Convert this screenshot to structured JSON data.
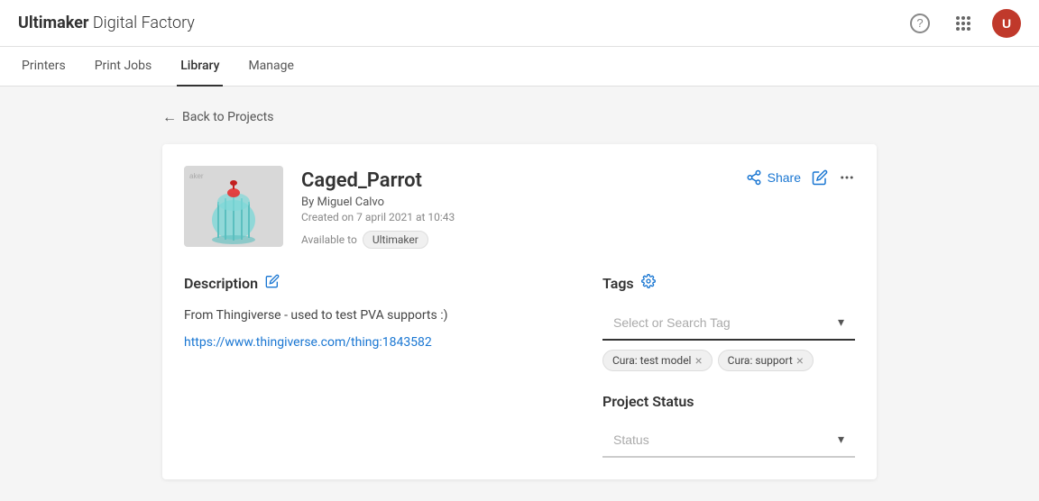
{
  "brand": {
    "name_bold": "Ultimaker",
    "name_light": " Digital Factory"
  },
  "top_nav": {
    "help_icon": "?",
    "grid_icon": "⋮⋮⋮",
    "avatar_label": "U"
  },
  "main_nav": {
    "items": [
      {
        "id": "printers",
        "label": "Printers",
        "active": false
      },
      {
        "id": "print-jobs",
        "label": "Print Jobs",
        "active": false
      },
      {
        "id": "library",
        "label": "Library",
        "active": true
      },
      {
        "id": "manage",
        "label": "Manage",
        "active": false
      }
    ]
  },
  "back_link": "Back to Projects",
  "project": {
    "title": "Caged_Parrot",
    "by": "By Miguel Calvo",
    "created": "Created on 7 april 2021 at 10:43",
    "available_to_label": "Available to",
    "available_to": "Ultimaker",
    "share_label": "Share",
    "description_header": "Description",
    "description_lines": [
      "From Thingiverse - used to test PVA supports :)",
      "https://www.thingiverse.com/thing:1843582"
    ]
  },
  "tags": {
    "header": "Tags",
    "dropdown_placeholder": "Select or Search Tag",
    "items": [
      {
        "label": "Cura: test model"
      },
      {
        "label": "Cura: support"
      }
    ]
  },
  "project_status": {
    "header": "Project Status",
    "dropdown_placeholder": "Status"
  },
  "chevron_down": "▾"
}
